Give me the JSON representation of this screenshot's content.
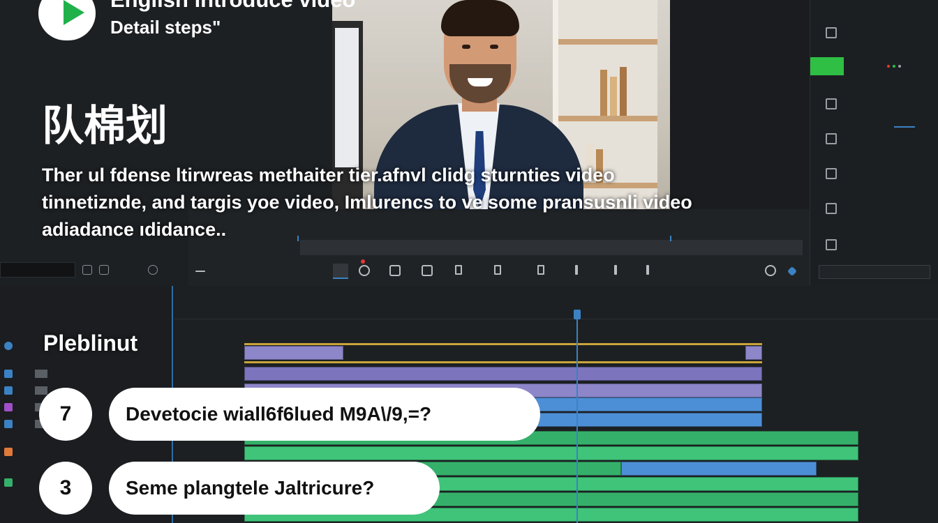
{
  "overlay": {
    "title": "English introduce video",
    "subtitle": "Detail steps\"",
    "cjk_heading": "队棉划",
    "paragraph": [
      "Ther ul fdense ltirwreas methaiter tier.afnvl clidg sturnties video",
      "tinnetiznde, and targis yoe video, Imlurencs to ve some pransusnli video",
      "adiadance ıdidance.."
    ],
    "section_title": "Pleblinut",
    "steps": [
      {
        "number": "7",
        "text": "Devetocie wiall6f6lued M9A\\/9,=?"
      },
      {
        "number": "3",
        "text": "Seme plangtele Jaltricure?"
      }
    ]
  },
  "colors": {
    "accent_blue": "#3b82c4",
    "clip_purple": "#8d86c9",
    "clip_blue": "#4d8fd6",
    "clip_green": "#35b06a",
    "brand_green": "#21b14b",
    "record_red": "#e53935"
  },
  "icons": [
    "play-logo-icon",
    "search-icon",
    "record-icon",
    "undo-icon",
    "add-icon"
  ]
}
